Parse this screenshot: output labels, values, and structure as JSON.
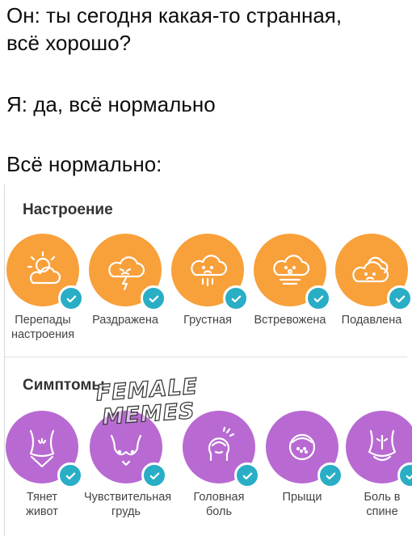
{
  "meme": {
    "line1": "Он: ты сегодня какая-то странная,",
    "line2": "всё хорошо?",
    "line3": "Я: да, всё нормально",
    "line4": "Всё нормально:"
  },
  "mood": {
    "title": "Настроение",
    "color": "#F8A03A",
    "items": [
      {
        "label": "Перепады\nнастроения",
        "icon": "sun-cloud-icon",
        "selected": true
      },
      {
        "label": "Раздражена",
        "icon": "lightning-cloud-icon",
        "selected": true
      },
      {
        "label": "Грустная",
        "icon": "rain-cloud-icon",
        "selected": true
      },
      {
        "label": "Встревожена",
        "icon": "fog-cloud-icon",
        "selected": true
      },
      {
        "label": "Подавлена",
        "icon": "heavy-cloud-icon",
        "selected": true
      }
    ]
  },
  "symptoms": {
    "title": "Симптомы",
    "color": "#B86AD2",
    "items": [
      {
        "label": "Тянет\nживот",
        "icon": "abdomen-icon",
        "selected": true
      },
      {
        "label": "Чувствительная\nгрудь",
        "icon": "breast-icon",
        "selected": true
      },
      {
        "label": "Головная\nболь",
        "icon": "headache-icon",
        "selected": true
      },
      {
        "label": "Прыщи",
        "icon": "acne-face-icon",
        "selected": true
      },
      {
        "label": "Боль в\nспине",
        "icon": "back-pain-icon",
        "selected": true
      }
    ]
  },
  "check_color": "#29AEC6",
  "watermark": "FEMALE\nMEMES"
}
